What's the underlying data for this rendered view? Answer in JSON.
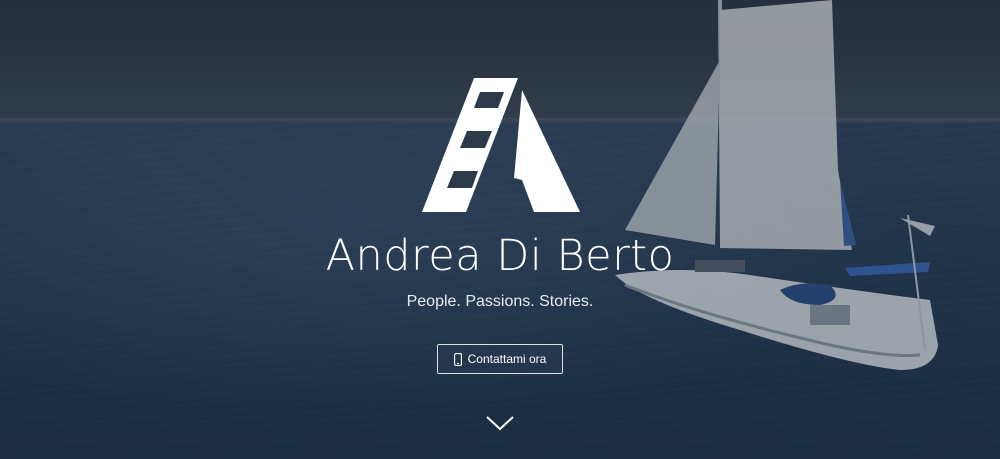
{
  "hero": {
    "brand_name": "Andrea Di Berto",
    "tagline": "People. Passions. Stories.",
    "cta_label": "Contattami ora",
    "icons": {
      "logo": "film-strip-a-logo",
      "cta_icon": "mobile-phone-icon",
      "scroll": "chevron-down-icon"
    },
    "colors": {
      "text": "#ffffff",
      "overlay": "#1e2a38",
      "sea": "#23364c"
    }
  }
}
